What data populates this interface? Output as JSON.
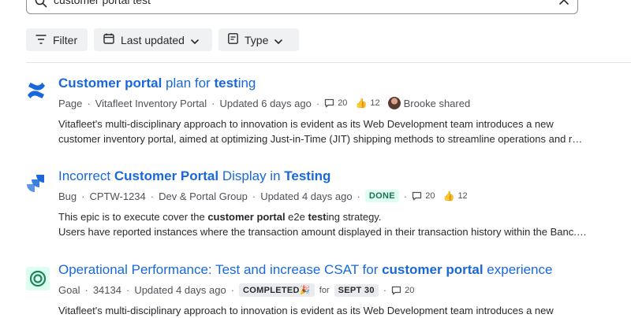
{
  "search": {
    "value": "customer portal test"
  },
  "toolbar": {
    "filter_label": "Filter",
    "updated_label": "Last updated",
    "type_label": "Type"
  },
  "results": [
    {
      "title_b1": "Customer portal",
      "title_t1": " plan for ",
      "title_b2": "test",
      "title_t2": "ing",
      "type": "Page",
      "space": "Vitafleet Inventory Portal",
      "updated": "Updated 6 days ago",
      "comments": "20",
      "likes": "12",
      "shared": "Brooke shared",
      "snippet_line1": "Vitafleet's multi-disciplinary approach to innovation is evident as its Web Development team introduces a new",
      "snippet_line2": "customer inventory portal, aimed at optimizing Just-in-Time (JIT) shipping methods to streamline operations and red…",
      "icon": "confluence-icon",
      "icon_color": "#1868db"
    },
    {
      "title_t1": "Incorrect ",
      "title_b1": "Customer Portal",
      "title_t2": " Display in ",
      "title_b2": "Testing",
      "type": "Bug",
      "key": "CPTW-1234",
      "project": "Dev & Portal Group",
      "updated": "Updated 4 days ago",
      "status": "DONE",
      "comments": "20",
      "likes": "12",
      "snippet_a": "This epic is to execute cover the ",
      "snippet_b": "customer portal",
      "snippet_c": " e2e ",
      "snippet_d": "test",
      "snippet_e": "ing strategy.",
      "snippet_line2": "Users have reported instances where the transaction amount displayed in their transaction history within the Banc.ly…",
      "icon": "jira-icon",
      "icon_color": "#1868db"
    },
    {
      "title_t1": "Operational Performance: Test and increase CSAT for ",
      "title_b1": "customer portal",
      "title_t2": " experience",
      "type": "Goal",
      "key": "34134",
      "updated": "Updated 4 days ago",
      "status": "COMPLETED",
      "status_emoji": "🎉",
      "for_label": "for",
      "date": "SEPT 30",
      "comments": "20",
      "snippet_line1": "Vitafleet's multi-disciplinary approach to innovation is evident as its Web Development team introduces a new",
      "icon": "goal-icon",
      "icon_color": "#1f845a"
    }
  ]
}
